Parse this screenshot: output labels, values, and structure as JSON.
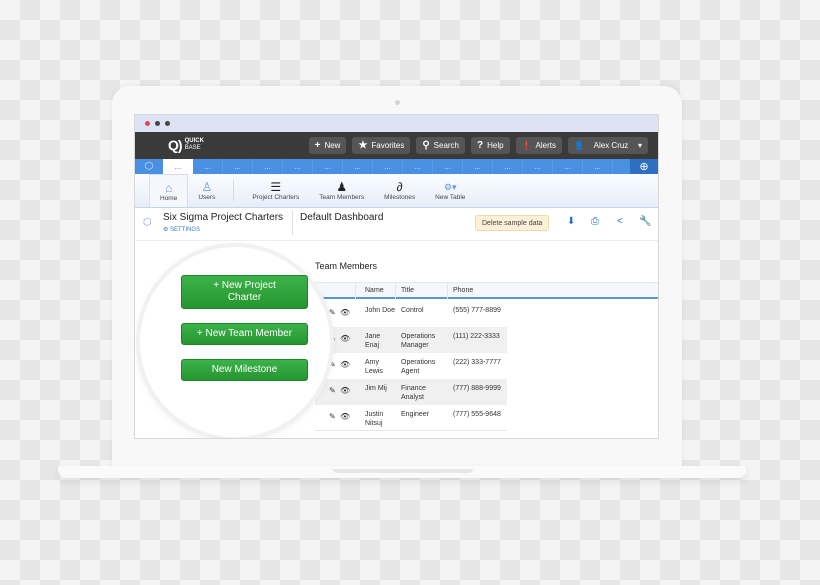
{
  "window": {
    "traffic_lights": [
      "#e2475a",
      "#444444",
      "#444444"
    ]
  },
  "topbar": {
    "logo_mark": "Q)",
    "logo_line1": "QUICK",
    "logo_line2": "BASE",
    "buttons": [
      {
        "icon": "+",
        "label": "New"
      },
      {
        "icon": "★",
        "label": "Favorites"
      },
      {
        "icon": "⚲",
        "label": "Search"
      },
      {
        "icon": "?",
        "label": "Help"
      },
      {
        "icon": "❗",
        "label": "Alerts"
      }
    ],
    "user": {
      "icon": "👤",
      "label": "Alex Cruz",
      "caret": "▾"
    }
  },
  "tabs": {
    "app_icon": "⬡",
    "items": [
      "...",
      "...",
      "...",
      "...",
      "...",
      "...",
      "...",
      "...",
      "...",
      "...",
      "...",
      "...",
      "...",
      "...",
      "..."
    ],
    "right_icon": "⊕"
  },
  "nav": {
    "items": [
      {
        "icon": "⌂",
        "label": "Home"
      },
      {
        "icon": "♙",
        "label": "Users"
      },
      {
        "icon": "☰",
        "label": "Project Charters"
      },
      {
        "icon": "♟",
        "label": "Team Members"
      },
      {
        "icon": "∂",
        "label": "Milestones"
      },
      {
        "icon": "⚙▾",
        "label": "New Table"
      }
    ]
  },
  "header": {
    "app_icon": "⬡",
    "app_name": "Six Sigma Project Charters",
    "settings_label": "⚙ SETTINGS",
    "dashboard_name": "Default Dashboard",
    "delete_label": "Delete sample data",
    "icons": [
      "⬇",
      "⎙",
      "<",
      "🔧"
    ]
  },
  "buttons": {
    "new_project_charter": "+ New Project Charter",
    "new_team_member": "+ New Team Member",
    "new_milestone": "New Milestone"
  },
  "team_members": {
    "title": "Team Members",
    "columns": [
      "Name",
      "Title",
      "Phone"
    ],
    "rows": [
      {
        "name": "John Doe",
        "title": "Control",
        "phone": "(555) 777-8899"
      },
      {
        "name": "Jane Enaj",
        "title": "Operations Manager",
        "phone": "(111) 222-3333"
      },
      {
        "name": "Amy Lewis",
        "title": "Operations Agent",
        "phone": "(222) 333-7777"
      },
      {
        "name": "Jim Mij",
        "title": "Finance Analyst",
        "phone": "(777) 888-9999"
      },
      {
        "name": "Justin Nitsuj",
        "title": "Engineer",
        "phone": "(777) 555-9648"
      }
    ],
    "edit_icon": "✎",
    "view_icon": "👁"
  }
}
